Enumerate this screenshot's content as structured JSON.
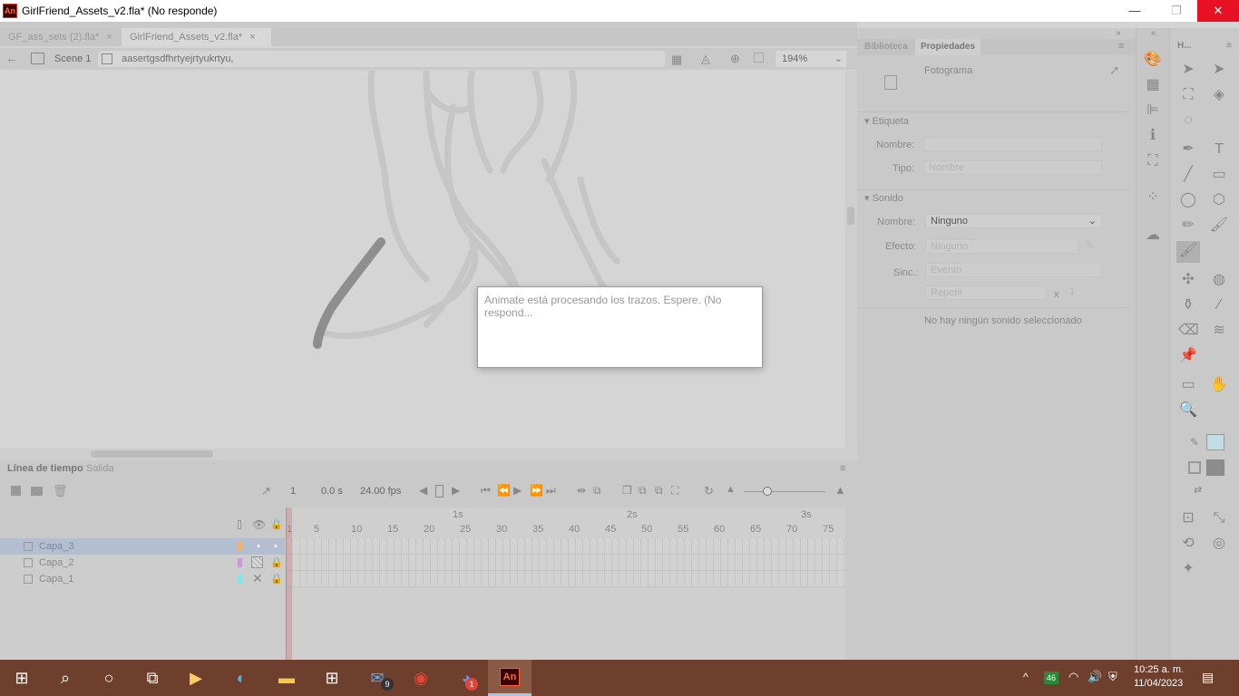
{
  "window": {
    "app_icon": "An",
    "title": "GirlFriend_Assets_v2.fla* (No responde)",
    "minimize": "—",
    "maximize": "❐",
    "close": "✕"
  },
  "doc_tabs": [
    {
      "label": "GF_ass_sets (2).fla*",
      "close": "×"
    },
    {
      "label": "GirlFriend_Assets_v2.fla*",
      "close": "×"
    }
  ],
  "scene_bar": {
    "scene": "Scene 1",
    "symbol_path": "aasertgsdfhrtyejrtyukrtyu,",
    "zoom": "194%"
  },
  "dialog": {
    "message": "Animate está procesando los trazos. Espere. (No respond..."
  },
  "timeline": {
    "tabs": [
      "Línea de tiempo",
      "Salida"
    ],
    "frame_current": "1",
    "time": "0.0 s",
    "fps": "24.00 fps",
    "seconds_labels": [
      "1s",
      "2s",
      "3s"
    ],
    "frame_numbers": [
      "1",
      "5",
      "10",
      "15",
      "20",
      "25",
      "30",
      "35",
      "40",
      "45",
      "50",
      "55",
      "60",
      "65",
      "70",
      "75"
    ],
    "layers": [
      {
        "name": "Capa_3",
        "color": "#f0b070",
        "selected": true
      },
      {
        "name": "Capa_2",
        "color": "#c89ad8",
        "selected": false
      },
      {
        "name": "Capa_1",
        "color": "#7fe8e8",
        "selected": false
      }
    ]
  },
  "properties": {
    "tabs": [
      "Biblioteca",
      "Propiedades"
    ],
    "header": "Fotograma",
    "label_section": "Etiqueta",
    "name_label": "Nombre:",
    "type_label": "Tipo:",
    "type_value": "Nombre",
    "sound_section": "Sonido",
    "sound_name_label": "Nombre:",
    "sound_name_value": "Ninguno",
    "effect_label": "Efecto:",
    "effect_value": "Ninguno",
    "sync_label": "Sinc.:",
    "sync_value": "Evento",
    "repeat_value": "Repetir",
    "repeat_x": "x",
    "repeat_count": "1",
    "no_sound": "No hay ningún sonido seleccionado"
  },
  "tools_header": "H...",
  "taskbar": {
    "time": "10:25 a. m.",
    "date": "11/04/2023",
    "mail_badge": "9",
    "discord_badge": "1",
    "tray_badge": "46",
    "animate_label": "An"
  }
}
